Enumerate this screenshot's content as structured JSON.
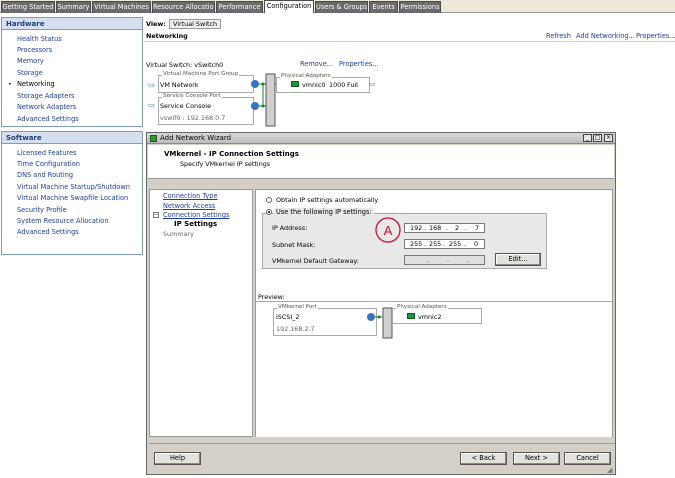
{
  "tabs": [
    "Getting Started",
    "Summary",
    "Virtual Machines",
    "Resource Allocation",
    "Performance",
    "Configuration",
    "Users & Groups",
    "Events",
    "Permissions"
  ],
  "hardware": {
    "title": "Hardware",
    "items": [
      "Health Status",
      "Processors",
      "Memory",
      "Storage",
      "Networking",
      "Storage Adapters",
      "Network Adapters",
      "Advanced Settings"
    ],
    "current": "Networking"
  },
  "software": {
    "title": "Software",
    "items": [
      "Licensed Features",
      "Time Configuration",
      "DNS and Routing",
      "Virtual Machine Startup/Shutdown",
      "Virtual Machine Swapfile Location",
      "Security Profile",
      "System Resource Allocation",
      "Advanced Settings"
    ]
  },
  "view": {
    "label": "View:",
    "value": "Virtual Switch"
  },
  "networking_title": "Networking",
  "top_actions": [
    "Refresh",
    "Add Networking...",
    "Properties..."
  ],
  "vswitch": {
    "label": "Virtual Switch: vSwitch0",
    "remove": "Remove...",
    "properties": "Properties...",
    "pg1_legend": "Virtual Machine Port Group",
    "pg1_name": "VM Network",
    "pg2_legend": "Service Console Port",
    "pg2_name": "Service Console",
    "pg2_detail": "vswif0 : 192.168.0.7",
    "pa_legend": "Physical Adapters",
    "nic": "vmnic0",
    "speed": "1000",
    "duplex": "Full"
  },
  "wizard": {
    "title": "Add Network Wizard",
    "heading": "VMkernel - IP Connection Settings",
    "subheading": "Specify VMkernel IP settings",
    "steps": [
      "Connection Type",
      "Network Access",
      "Connection Settings"
    ],
    "substep": "IP Settings",
    "summary": "Summary",
    "radio_auto": "Obtain IP settings automatically",
    "radio_manual": "Use the following IP settings:",
    "ip_label": "IP Address:",
    "ip": [
      "192",
      "168",
      "2",
      "7"
    ],
    "mask_label": "Subnet Mask:",
    "mask": [
      "255",
      "255",
      "255",
      "0"
    ],
    "gw_label": "VMkernel Default Gateway:",
    "gw": [
      ".",
      ".",
      "."
    ],
    "edit": "Edit...",
    "callout": "A",
    "preview_label": "Preview:",
    "pv_port_legend": "VMkernel Port",
    "pv_port_name": "iSCSI_2",
    "pv_port_ip": "192.168.2.7",
    "pv_pa_legend": "Physical Adapters",
    "pv_nic": "vmnic2",
    "help": "Help",
    "back": "< Back",
    "next": "Next >",
    "cancel": "Cancel"
  }
}
